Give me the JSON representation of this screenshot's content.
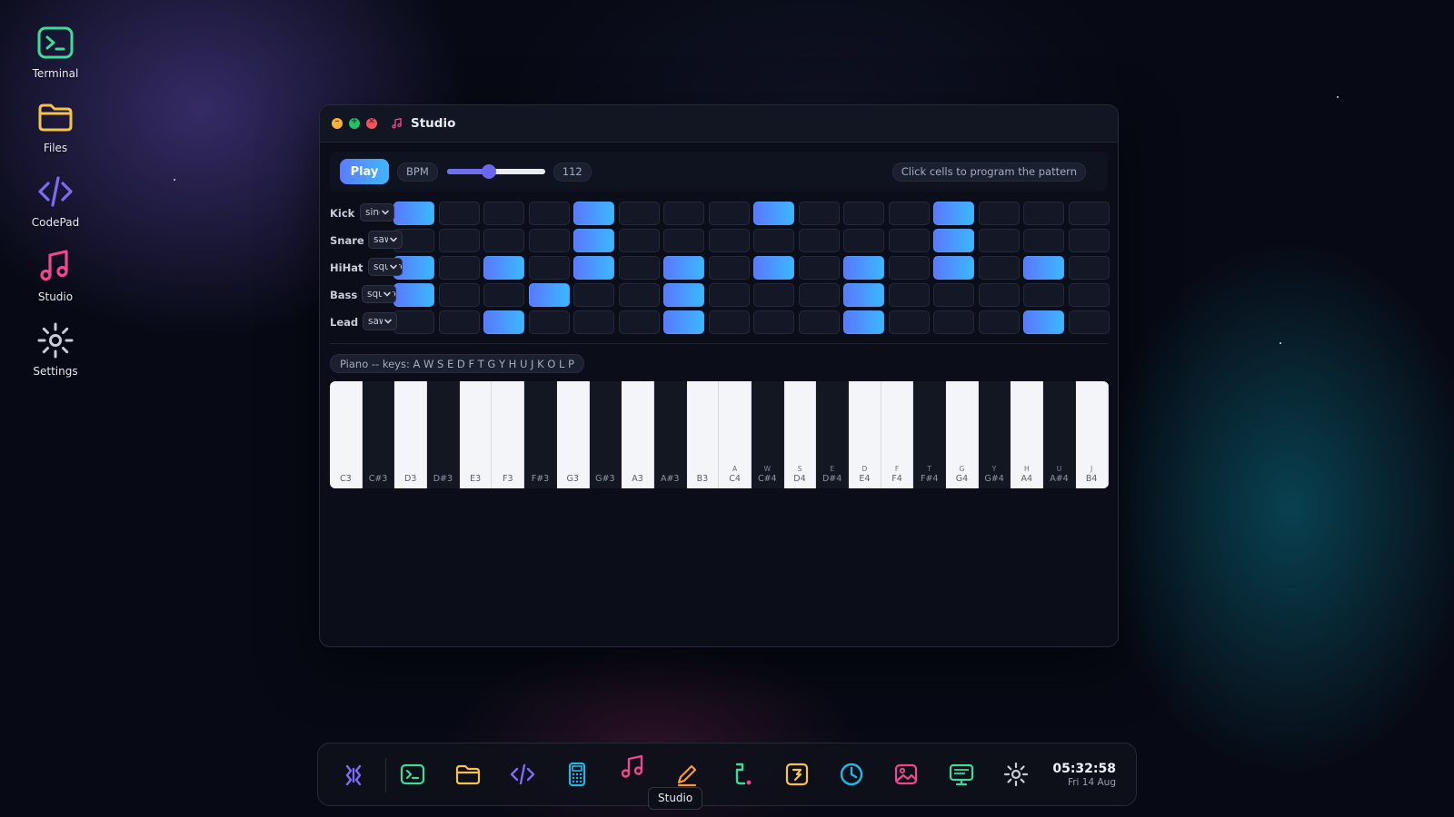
{
  "desktop": {
    "icons": [
      {
        "label": "Terminal",
        "icon": "terminal-icon",
        "color": "#3ddc97"
      },
      {
        "label": "Files",
        "icon": "folder-icon",
        "color": "#f6c24a"
      },
      {
        "label": "CodePad",
        "icon": "code-icon",
        "color": "#7b6cf6"
      },
      {
        "label": "Studio",
        "icon": "music-note-icon",
        "color": "#f0478f"
      },
      {
        "label": "Settings",
        "icon": "gear-icon",
        "color": "#c9cdda"
      }
    ]
  },
  "window": {
    "title": "Studio",
    "toolbar": {
      "play_label": "Play",
      "bpm_label": "BPM",
      "bpm_value": "112",
      "bpm_fraction": 0.43,
      "hint": "Click cells to program the pattern"
    },
    "tracks": [
      {
        "name": "Kick",
        "wave": "sine",
        "steps": [
          1,
          0,
          0,
          0,
          1,
          0,
          0,
          0,
          1,
          0,
          0,
          0,
          1,
          0,
          0,
          0
        ]
      },
      {
        "name": "Snare",
        "wave": "saw",
        "steps": [
          0,
          0,
          0,
          0,
          1,
          0,
          0,
          0,
          0,
          0,
          0,
          0,
          1,
          0,
          0,
          0
        ]
      },
      {
        "name": "HiHat",
        "wave": "square",
        "steps": [
          1,
          0,
          1,
          0,
          1,
          0,
          1,
          0,
          1,
          0,
          1,
          0,
          1,
          0,
          1,
          0
        ]
      },
      {
        "name": "Bass",
        "wave": "square",
        "steps": [
          1,
          0,
          0,
          1,
          0,
          0,
          1,
          0,
          0,
          0,
          1,
          0,
          0,
          0,
          0,
          0
        ]
      },
      {
        "name": "Lead",
        "wave": "saw",
        "steps": [
          0,
          0,
          1,
          0,
          0,
          0,
          1,
          0,
          0,
          0,
          1,
          0,
          0,
          0,
          1,
          0
        ]
      }
    ],
    "piano_hint": "Piano -- keys: A W S E D F T G Y H U J K O L P",
    "piano_keys": [
      {
        "note": "C3",
        "kb": "",
        "black": false
      },
      {
        "note": "C#3",
        "kb": "",
        "black": true
      },
      {
        "note": "D3",
        "kb": "",
        "black": false
      },
      {
        "note": "D#3",
        "kb": "",
        "black": true
      },
      {
        "note": "E3",
        "kb": "",
        "black": false
      },
      {
        "note": "F3",
        "kb": "",
        "black": false
      },
      {
        "note": "F#3",
        "kb": "",
        "black": true
      },
      {
        "note": "G3",
        "kb": "",
        "black": false
      },
      {
        "note": "G#3",
        "kb": "",
        "black": true
      },
      {
        "note": "A3",
        "kb": "",
        "black": false
      },
      {
        "note": "A#3",
        "kb": "",
        "black": true
      },
      {
        "note": "B3",
        "kb": "",
        "black": false
      },
      {
        "note": "C4",
        "kb": "A",
        "black": false
      },
      {
        "note": "C#4",
        "kb": "W",
        "black": true
      },
      {
        "note": "D4",
        "kb": "S",
        "black": false
      },
      {
        "note": "D#4",
        "kb": "E",
        "black": true
      },
      {
        "note": "E4",
        "kb": "D",
        "black": false
      },
      {
        "note": "F4",
        "kb": "F",
        "black": false
      },
      {
        "note": "F#4",
        "kb": "T",
        "black": true
      },
      {
        "note": "G4",
        "kb": "G",
        "black": false
      },
      {
        "note": "G#4",
        "kb": "Y",
        "black": true
      },
      {
        "note": "A4",
        "kb": "H",
        "black": false
      },
      {
        "note": "A#4",
        "kb": "U",
        "black": true
      },
      {
        "note": "B4",
        "kb": "J",
        "black": false
      }
    ]
  },
  "dock": {
    "items": [
      {
        "name": "launcher-icon",
        "color": "#7b6cf6"
      },
      {
        "name": "terminal-icon",
        "color": "#3ddc97"
      },
      {
        "name": "folder-icon",
        "color": "#f6c24a"
      },
      {
        "name": "code-icon",
        "color": "#7b6cf6"
      },
      {
        "name": "calculator-icon",
        "color": "#22b8e6"
      },
      {
        "name": "music-note-icon",
        "color": "#f0478f"
      },
      {
        "name": "pencil-icon",
        "color": "#f39a3a"
      },
      {
        "name": "snake-icon",
        "color": "#3ddc97"
      },
      {
        "name": "notes-icon",
        "color": "#f6c24a"
      },
      {
        "name": "clock-icon",
        "color": "#22b8e6"
      },
      {
        "name": "image-icon",
        "color": "#f0478f"
      },
      {
        "name": "monitor-icon",
        "color": "#3ddc97"
      },
      {
        "name": "gear-icon",
        "color": "#c9cdda"
      }
    ],
    "time": "05:32:58",
    "date": "Fri 14 Aug",
    "tooltip": "Studio"
  }
}
